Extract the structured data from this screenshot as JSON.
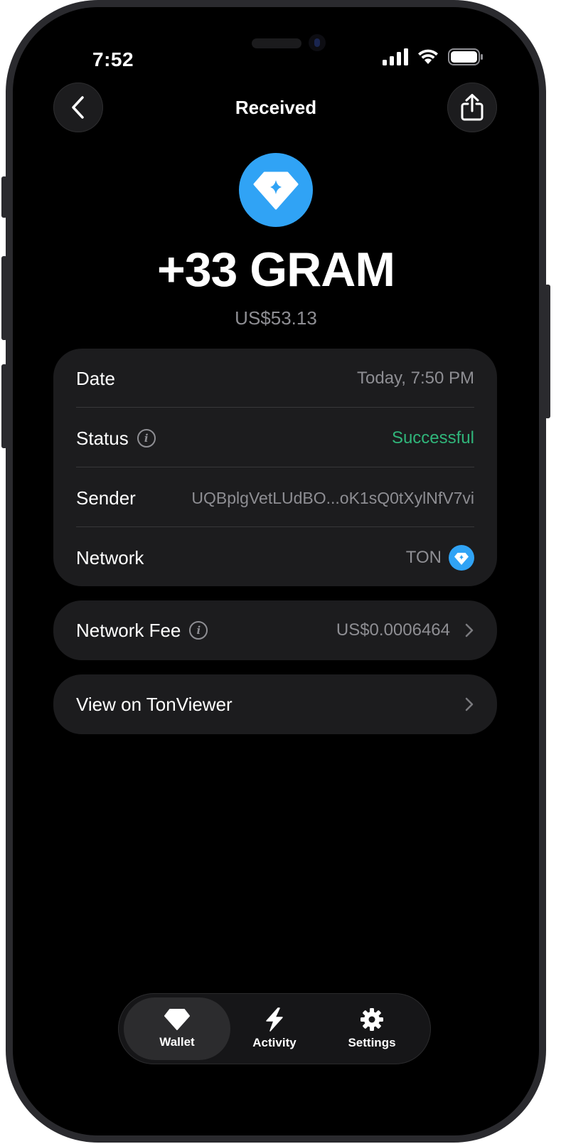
{
  "status_bar": {
    "time": "7:52"
  },
  "header": {
    "title": "Received",
    "back_icon": "chevron-left-icon",
    "share_icon": "share-icon"
  },
  "transaction": {
    "token_icon": "gem-icon",
    "amount": "+33 GRAM",
    "fiat_value": "US$53.13"
  },
  "details": {
    "date": {
      "label": "Date",
      "value": "Today, 7:50 PM"
    },
    "status": {
      "label": "Status",
      "value": "Successful",
      "color": "#30b57a"
    },
    "sender": {
      "label": "Sender",
      "value": "UQBplgVetLUdBO...oK1sQ0tXylNfV7vi"
    },
    "network": {
      "label": "Network",
      "value": "TON"
    }
  },
  "fee": {
    "label": "Network Fee",
    "value": "US$0.0006464"
  },
  "explorer": {
    "label": "View on TonViewer"
  },
  "tabbar": {
    "tabs": [
      {
        "label": "Wallet",
        "icon": "gem-icon",
        "active": true
      },
      {
        "label": "Activity",
        "icon": "bolt-icon",
        "active": false
      },
      {
        "label": "Settings",
        "icon": "gear-icon",
        "active": false
      }
    ]
  },
  "colors": {
    "accent": "#30a3f5",
    "background": "#000000",
    "card": "#1c1c1e",
    "secondary_text": "#8e8e93"
  }
}
